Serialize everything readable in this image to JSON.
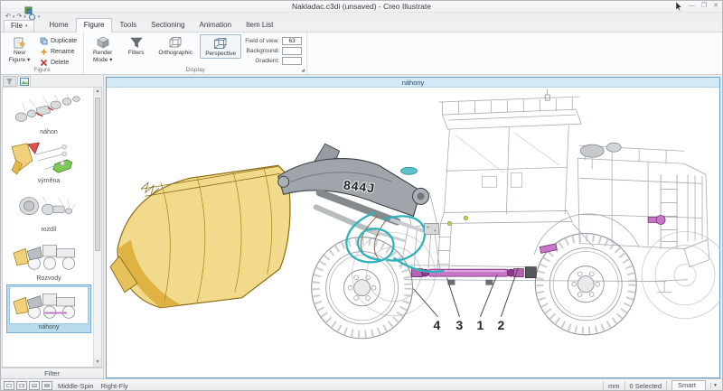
{
  "window": {
    "title": "Nakladac.c3di (unsaved) - Creo Illustrate"
  },
  "menu": {
    "file_label": "File"
  },
  "tabs": {
    "items": [
      "Home",
      "Figure",
      "Tools",
      "Sectioning",
      "Animation",
      "Item List"
    ],
    "active": "Figure"
  },
  "ribbon": {
    "figure_group": {
      "label": "Figure",
      "new_figure_line1": "New",
      "new_figure_line2": "Figure",
      "duplicate": "Duplicate",
      "rename": "Rename",
      "delete": "Delete"
    },
    "display_group": {
      "label": "Display",
      "render_line1": "Render",
      "render_line2": "Mode",
      "filters": "Filters",
      "orthographic": "Orthographic",
      "perspective": "Perspective",
      "field_of_view_label": "Field of view:",
      "field_of_view_value": "63",
      "background_label": "Background:",
      "gradient_label": "Gradient:"
    }
  },
  "sidebar": {
    "figures": [
      {
        "label": "náhon",
        "selected": false
      },
      {
        "label": "výměna",
        "selected": false
      },
      {
        "label": "rozdíl",
        "selected": false
      },
      {
        "label": "Rozvody",
        "selected": false
      },
      {
        "label": "náhony",
        "selected": true
      }
    ],
    "filter_label": "Filter"
  },
  "canvas": {
    "figure_title": "náhony",
    "model_label": "844J",
    "callouts": [
      "4",
      "3",
      "1",
      "2"
    ]
  },
  "statusbar": {
    "middle_mode": "Middle-Spin",
    "right_mode": "Right-Fly",
    "units": "mm",
    "selection": "0 Selected",
    "snap_mode": "Smart"
  },
  "colors": {
    "bucket_yellow": "#f2da8c",
    "boom_gray": "#9fa5aa",
    "hose_cyan": "#2fb3ba",
    "shaft_magenta": "#c877c8",
    "selection_blue": "#badbee",
    "canvas_border_blue": "#6aa2cf"
  }
}
